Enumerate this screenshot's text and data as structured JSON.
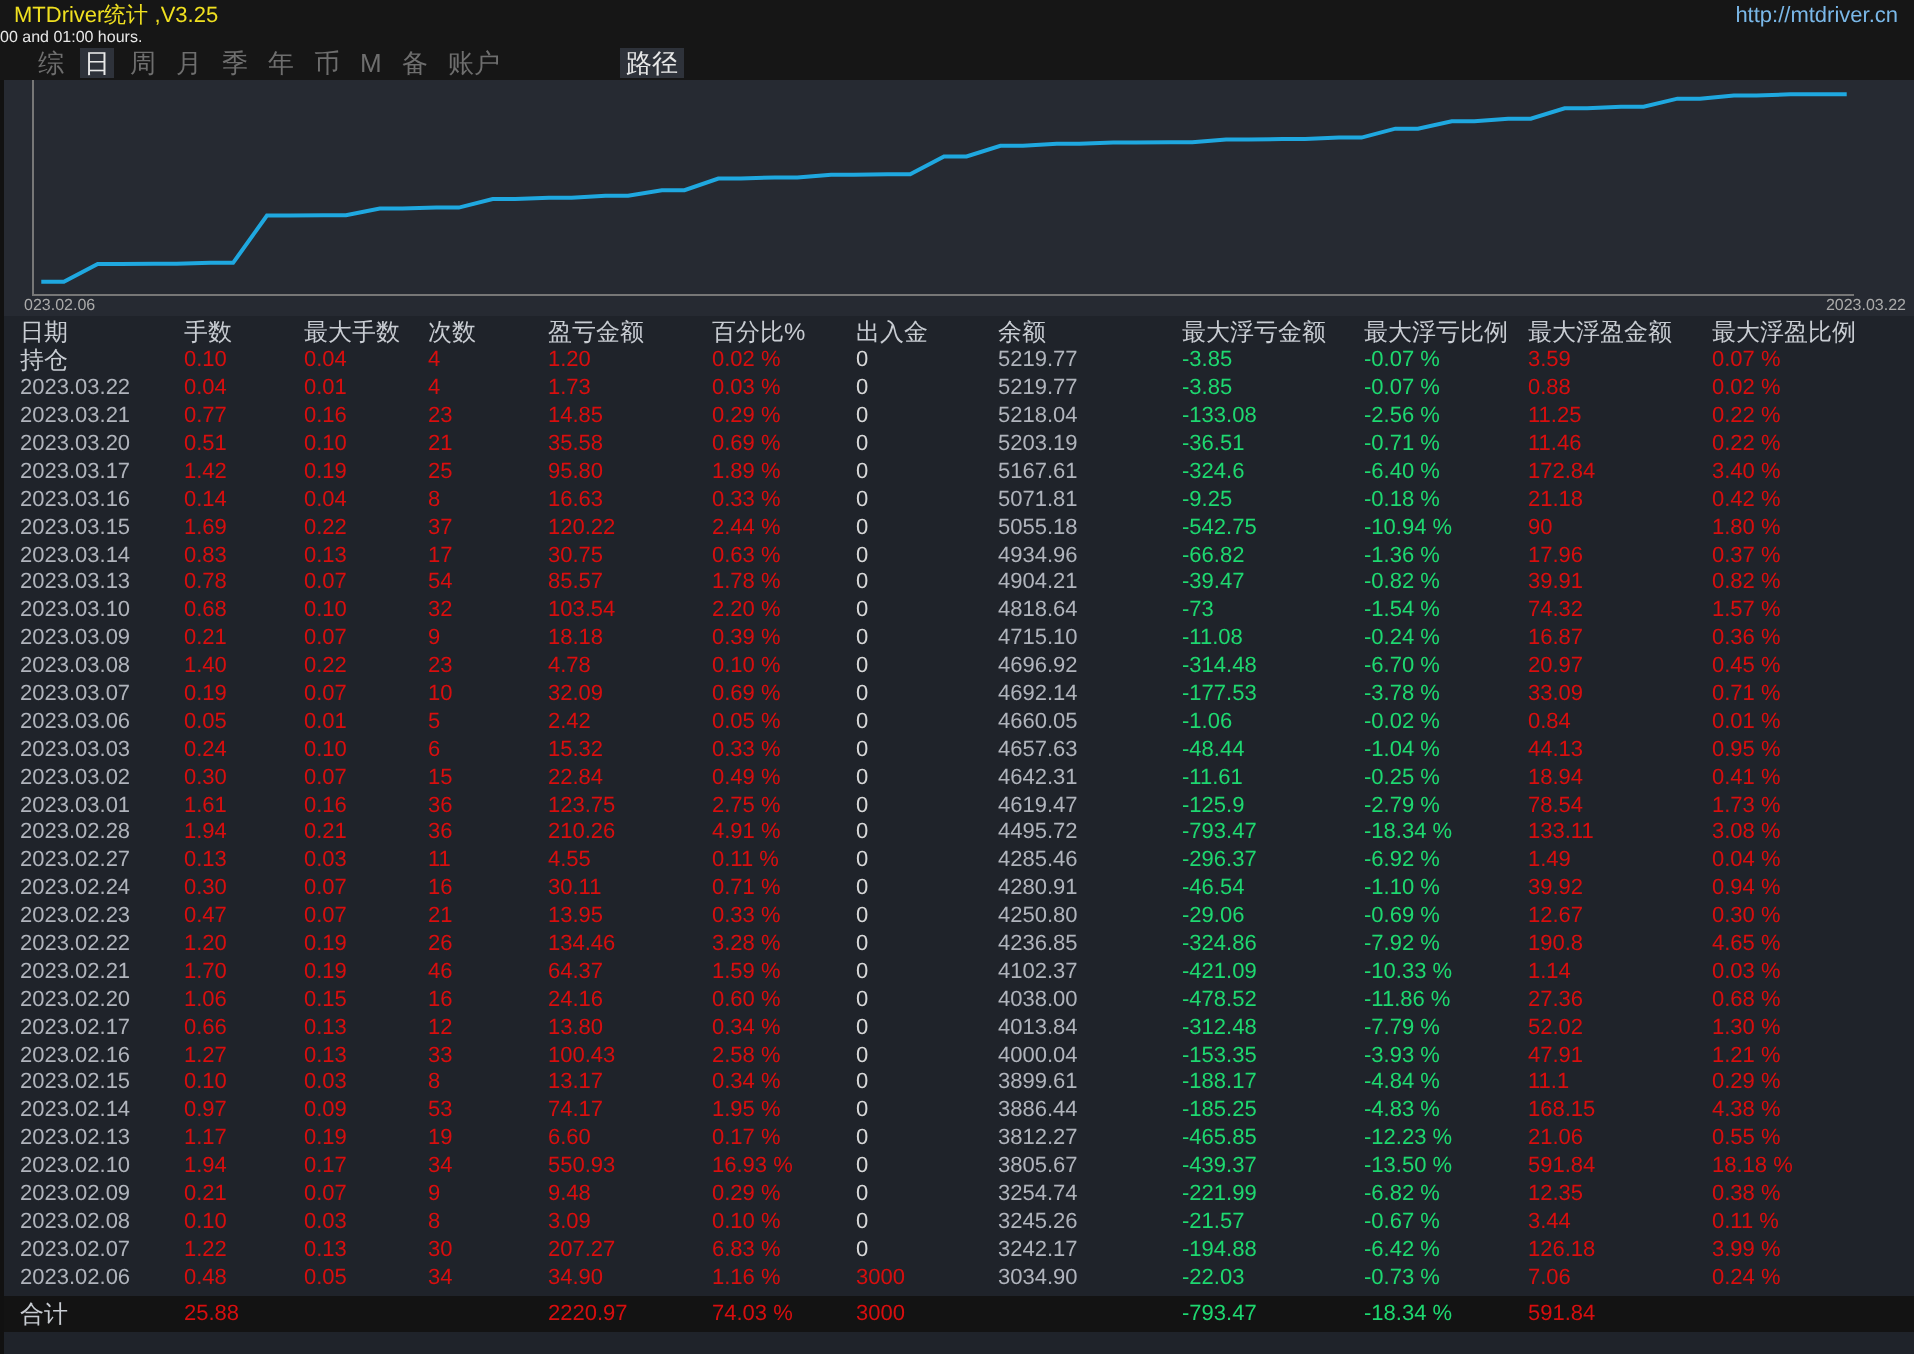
{
  "window": {
    "title": "MTDriver统计 ,V3.25",
    "url": "http://mtdriver.cn",
    "notice": "00 and 01:00 hours."
  },
  "tabs": [
    {
      "label": "综",
      "selected": false
    },
    {
      "label": "日",
      "selected": true
    },
    {
      "label": "周",
      "selected": false
    },
    {
      "label": "月",
      "selected": false
    },
    {
      "label": "季",
      "selected": false
    },
    {
      "label": "年",
      "selected": false
    },
    {
      "label": "币",
      "selected": false
    },
    {
      "label": "M",
      "selected": false
    },
    {
      "label": "备",
      "selected": false
    },
    {
      "label": "账户",
      "selected": false
    }
  ],
  "path_button": "路径",
  "chart": {
    "start_label": "023.02.06",
    "end_label": "2023.03.22"
  },
  "table": {
    "columns": [
      "日期",
      "手数",
      "最大手数",
      "次数",
      "盈亏金额",
      "百分比%",
      "出入金",
      "余额",
      "最大浮亏金额",
      "最大浮亏比例",
      "最大浮盈金额",
      "最大浮盈比例"
    ],
    "rows": [
      {
        "kind": "holding",
        "deposit": false,
        "cells": [
          "持仓",
          "0.10",
          "0.04",
          "4",
          "1.20",
          "0.02 %",
          "0",
          "5219.77",
          "-3.85",
          "-0.07 %",
          "3.59",
          "0.07 %"
        ]
      },
      {
        "kind": "day",
        "deposit": false,
        "cells": [
          "2023.03.22",
          "0.04",
          "0.01",
          "4",
          "1.73",
          "0.03 %",
          "0",
          "5219.77",
          "-3.85",
          "-0.07 %",
          "0.88",
          "0.02 %"
        ]
      },
      {
        "kind": "day",
        "deposit": false,
        "cells": [
          "2023.03.21",
          "0.77",
          "0.16",
          "23",
          "14.85",
          "0.29 %",
          "0",
          "5218.04",
          "-133.08",
          "-2.56 %",
          "11.25",
          "0.22 %"
        ]
      },
      {
        "kind": "day",
        "deposit": false,
        "cells": [
          "2023.03.20",
          "0.51",
          "0.10",
          "21",
          "35.58",
          "0.69 %",
          "0",
          "5203.19",
          "-36.51",
          "-0.71 %",
          "11.46",
          "0.22 %"
        ]
      },
      {
        "kind": "day",
        "deposit": false,
        "cells": [
          "2023.03.17",
          "1.42",
          "0.19",
          "25",
          "95.80",
          "1.89 %",
          "0",
          "5167.61",
          "-324.6",
          "-6.40 %",
          "172.84",
          "3.40 %"
        ]
      },
      {
        "kind": "day",
        "deposit": false,
        "cells": [
          "2023.03.16",
          "0.14",
          "0.04",
          "8",
          "16.63",
          "0.33 %",
          "0",
          "5071.81",
          "-9.25",
          "-0.18 %",
          "21.18",
          "0.42 %"
        ]
      },
      {
        "kind": "day",
        "deposit": false,
        "cells": [
          "2023.03.15",
          "1.69",
          "0.22",
          "37",
          "120.22",
          "2.44 %",
          "0",
          "5055.18",
          "-542.75",
          "-10.94 %",
          "90",
          "1.80 %"
        ]
      },
      {
        "kind": "day",
        "deposit": false,
        "cells": [
          "2023.03.14",
          "0.83",
          "0.13",
          "17",
          "30.75",
          "0.63 %",
          "0",
          "4934.96",
          "-66.82",
          "-1.36 %",
          "17.96",
          "0.37 %"
        ]
      },
      {
        "kind": "day",
        "deposit": false,
        "cells": [
          "2023.03.13",
          "0.78",
          "0.07",
          "54",
          "85.57",
          "1.78 %",
          "0",
          "4904.21",
          "-39.47",
          "-0.82 %",
          "39.91",
          "0.82 %"
        ]
      },
      {
        "kind": "day",
        "deposit": false,
        "cells": [
          "2023.03.10",
          "0.68",
          "0.10",
          "32",
          "103.54",
          "2.20 %",
          "0",
          "4818.64",
          "-73",
          "-1.54 %",
          "74.32",
          "1.57 %"
        ]
      },
      {
        "kind": "day",
        "deposit": false,
        "cells": [
          "2023.03.09",
          "0.21",
          "0.07",
          "9",
          "18.18",
          "0.39 %",
          "0",
          "4715.10",
          "-11.08",
          "-0.24 %",
          "16.87",
          "0.36 %"
        ]
      },
      {
        "kind": "day",
        "deposit": false,
        "cells": [
          "2023.03.08",
          "1.40",
          "0.22",
          "23",
          "4.78",
          "0.10 %",
          "0",
          "4696.92",
          "-314.48",
          "-6.70 %",
          "20.97",
          "0.45 %"
        ]
      },
      {
        "kind": "day",
        "deposit": false,
        "cells": [
          "2023.03.07",
          "0.19",
          "0.07",
          "10",
          "32.09",
          "0.69 %",
          "0",
          "4692.14",
          "-177.53",
          "-3.78 %",
          "33.09",
          "0.71 %"
        ]
      },
      {
        "kind": "day",
        "deposit": false,
        "cells": [
          "2023.03.06",
          "0.05",
          "0.01",
          "5",
          "2.42",
          "0.05 %",
          "0",
          "4660.05",
          "-1.06",
          "-0.02 %",
          "0.84",
          "0.01 %"
        ]
      },
      {
        "kind": "day",
        "deposit": false,
        "cells": [
          "2023.03.03",
          "0.24",
          "0.10",
          "6",
          "15.32",
          "0.33 %",
          "0",
          "4657.63",
          "-48.44",
          "-1.04 %",
          "44.13",
          "0.95 %"
        ]
      },
      {
        "kind": "day",
        "deposit": false,
        "cells": [
          "2023.03.02",
          "0.30",
          "0.07",
          "15",
          "22.84",
          "0.49 %",
          "0",
          "4642.31",
          "-11.61",
          "-0.25 %",
          "18.94",
          "0.41 %"
        ]
      },
      {
        "kind": "day",
        "deposit": false,
        "cells": [
          "2023.03.01",
          "1.61",
          "0.16",
          "36",
          "123.75",
          "2.75 %",
          "0",
          "4619.47",
          "-125.9",
          "-2.79 %",
          "78.54",
          "1.73 %"
        ]
      },
      {
        "kind": "day",
        "deposit": false,
        "cells": [
          "2023.02.28",
          "1.94",
          "0.21",
          "36",
          "210.26",
          "4.91 %",
          "0",
          "4495.72",
          "-793.47",
          "-18.34 %",
          "133.11",
          "3.08 %"
        ]
      },
      {
        "kind": "day",
        "deposit": false,
        "cells": [
          "2023.02.27",
          "0.13",
          "0.03",
          "11",
          "4.55",
          "0.11 %",
          "0",
          "4285.46",
          "-296.37",
          "-6.92 %",
          "1.49",
          "0.04 %"
        ]
      },
      {
        "kind": "day",
        "deposit": false,
        "cells": [
          "2023.02.24",
          "0.30",
          "0.07",
          "16",
          "30.11",
          "0.71 %",
          "0",
          "4280.91",
          "-46.54",
          "-1.10 %",
          "39.92",
          "0.94 %"
        ]
      },
      {
        "kind": "day",
        "deposit": false,
        "cells": [
          "2023.02.23",
          "0.47",
          "0.07",
          "21",
          "13.95",
          "0.33 %",
          "0",
          "4250.80",
          "-29.06",
          "-0.69 %",
          "12.67",
          "0.30 %"
        ]
      },
      {
        "kind": "day",
        "deposit": false,
        "cells": [
          "2023.02.22",
          "1.20",
          "0.19",
          "26",
          "134.46",
          "3.28 %",
          "0",
          "4236.85",
          "-324.86",
          "-7.92 %",
          "190.8",
          "4.65 %"
        ]
      },
      {
        "kind": "day",
        "deposit": false,
        "cells": [
          "2023.02.21",
          "1.70",
          "0.19",
          "46",
          "64.37",
          "1.59 %",
          "0",
          "4102.37",
          "-421.09",
          "-10.33 %",
          "1.14",
          "0.03 %"
        ]
      },
      {
        "kind": "day",
        "deposit": false,
        "cells": [
          "2023.02.20",
          "1.06",
          "0.15",
          "16",
          "24.16",
          "0.60 %",
          "0",
          "4038.00",
          "-478.52",
          "-11.86 %",
          "27.36",
          "0.68 %"
        ]
      },
      {
        "kind": "day",
        "deposit": false,
        "cells": [
          "2023.02.17",
          "0.66",
          "0.13",
          "12",
          "13.80",
          "0.34 %",
          "0",
          "4013.84",
          "-312.48",
          "-7.79 %",
          "52.02",
          "1.30 %"
        ]
      },
      {
        "kind": "day",
        "deposit": false,
        "cells": [
          "2023.02.16",
          "1.27",
          "0.13",
          "33",
          "100.43",
          "2.58 %",
          "0",
          "4000.04",
          "-153.35",
          "-3.93 %",
          "47.91",
          "1.21 %"
        ]
      },
      {
        "kind": "day",
        "deposit": false,
        "cells": [
          "2023.02.15",
          "0.10",
          "0.03",
          "8",
          "13.17",
          "0.34 %",
          "0",
          "3899.61",
          "-188.17",
          "-4.84 %",
          "11.1",
          "0.29 %"
        ]
      },
      {
        "kind": "day",
        "deposit": false,
        "cells": [
          "2023.02.14",
          "0.97",
          "0.09",
          "53",
          "74.17",
          "1.95 %",
          "0",
          "3886.44",
          "-185.25",
          "-4.83 %",
          "168.15",
          "4.38 %"
        ]
      },
      {
        "kind": "day",
        "deposit": false,
        "cells": [
          "2023.02.13",
          "1.17",
          "0.19",
          "19",
          "6.60",
          "0.17 %",
          "0",
          "3812.27",
          "-465.85",
          "-12.23 %",
          "21.06",
          "0.55 %"
        ]
      },
      {
        "kind": "day",
        "deposit": false,
        "cells": [
          "2023.02.10",
          "1.94",
          "0.17",
          "34",
          "550.93",
          "16.93 %",
          "0",
          "3805.67",
          "-439.37",
          "-13.50 %",
          "591.84",
          "18.18 %"
        ]
      },
      {
        "kind": "day",
        "deposit": false,
        "cells": [
          "2023.02.09",
          "0.21",
          "0.07",
          "9",
          "9.48",
          "0.29 %",
          "0",
          "3254.74",
          "-221.99",
          "-6.82 %",
          "12.35",
          "0.38 %"
        ]
      },
      {
        "kind": "day",
        "deposit": false,
        "cells": [
          "2023.02.08",
          "0.10",
          "0.03",
          "8",
          "3.09",
          "0.10 %",
          "0",
          "3245.26",
          "-21.57",
          "-0.67 %",
          "3.44",
          "0.11 %"
        ]
      },
      {
        "kind": "day",
        "deposit": false,
        "cells": [
          "2023.02.07",
          "1.22",
          "0.13",
          "30",
          "207.27",
          "6.83 %",
          "0",
          "3242.17",
          "-194.88",
          "-6.42 %",
          "126.18",
          "3.99 %"
        ]
      },
      {
        "kind": "day",
        "deposit": true,
        "cells": [
          "2023.02.06",
          "0.48",
          "0.05",
          "34",
          "34.90",
          "1.16 %",
          "3000",
          "3034.90",
          "-22.03",
          "-0.73 %",
          "7.06",
          "0.24 %"
        ]
      }
    ],
    "total": {
      "label": "合计",
      "lots": "25.88",
      "pnl": "2220.97",
      "pct": "74.03 %",
      "in_out": "3000",
      "max_float_loss": "-793.47",
      "max_float_loss_pct": "-18.34 %",
      "max_float_profit": "591.84"
    }
  }
}
